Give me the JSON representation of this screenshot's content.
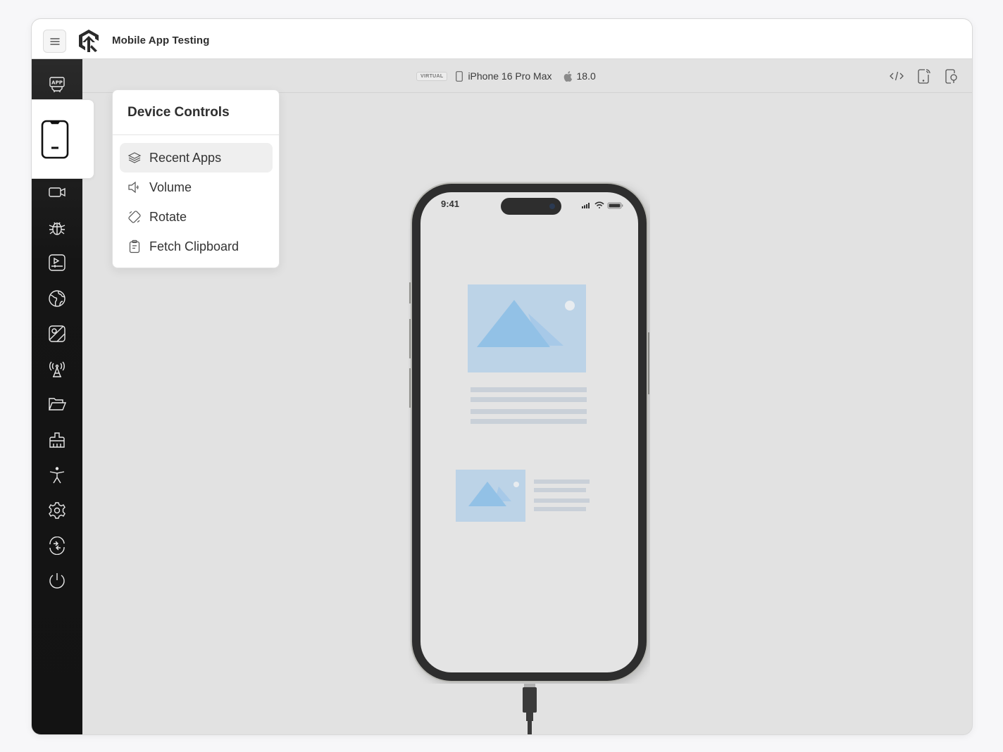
{
  "header": {
    "title": "Mobile App Testing",
    "menu_icon": "hamburger-icon",
    "logo_icon": "brand-logo-icon"
  },
  "sidebar": {
    "items": [
      {
        "name": "app-icon",
        "label": "App"
      },
      {
        "name": "device-controls-icon",
        "label": "Device Controls",
        "active": true
      },
      {
        "name": "video-camera-icon",
        "label": "Camera"
      },
      {
        "name": "bug-icon",
        "label": "Debug"
      },
      {
        "name": "media-icon",
        "label": "Media"
      },
      {
        "name": "globe-icon",
        "label": "Network"
      },
      {
        "name": "location-map-icon",
        "label": "Location"
      },
      {
        "name": "antenna-icon",
        "label": "Signal"
      },
      {
        "name": "folder-icon",
        "label": "Files"
      },
      {
        "name": "brush-icon",
        "label": "Clean"
      },
      {
        "name": "accessibility-icon",
        "label": "Accessibility"
      },
      {
        "name": "gear-icon",
        "label": "Settings"
      },
      {
        "name": "switch-icon",
        "label": "Switch Device"
      },
      {
        "name": "power-icon",
        "label": "Stop Session"
      }
    ],
    "app_badge_text": "APP"
  },
  "toolbar": {
    "badge": "VIRTUAL",
    "device_name": "iPhone 16 Pro Max",
    "os_version": "18.0",
    "icons": [
      "code-icon",
      "phone-signal-icon",
      "phone-search-icon"
    ]
  },
  "popover": {
    "title": "Device Controls",
    "items": [
      {
        "label": "Recent Apps",
        "icon": "layers-icon",
        "selected": true
      },
      {
        "label": "Volume",
        "icon": "speaker-icon",
        "selected": false
      },
      {
        "label": "Rotate",
        "icon": "rotate-icon",
        "selected": false
      },
      {
        "label": "Fetch Clipboard",
        "icon": "clipboard-icon",
        "selected": false
      }
    ]
  },
  "phone": {
    "status_time": "9:41"
  },
  "colors": {
    "sidebar_bg": "#131313",
    "stage_bg": "#e2e2e2",
    "placeholder_blue": "#bcd3e7",
    "mountain_blue": "#92c1e6"
  }
}
